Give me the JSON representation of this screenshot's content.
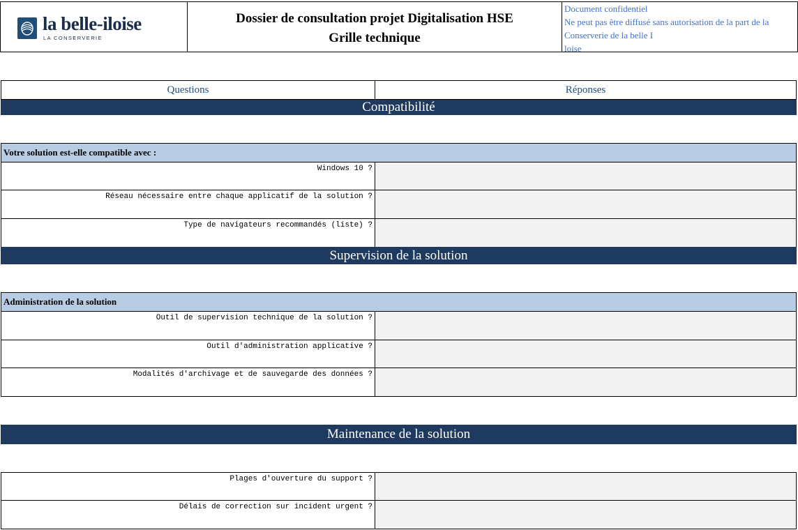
{
  "header": {
    "logo": {
      "name": "la belle-iloise",
      "tagline": "LA CONSERVERIE",
      "icon": "fish-tin-logo-icon"
    },
    "title_line1": "Dossier de consultation projet Digitalisation HSE",
    "title_line2": "Grille technique",
    "confidential": [
      "Document confidentiel",
      "Ne peut pas être diffusé sans autorisation de la part de la",
      "Conserverie de la  belle I",
      "loise"
    ]
  },
  "columns": {
    "questions": "Questions",
    "answers": "Réponses"
  },
  "sections": [
    {
      "title": "Compatibilité",
      "subheader": "Votre solution est-elle compatible avec :",
      "rows": [
        {
          "q": "Windows 10 ?",
          "a": ""
        },
        {
          "q": "Réseau nécessaire entre chaque applicatif de la solution ?",
          "a": ""
        },
        {
          "q": "Type de navigateurs recommandés (liste) ?",
          "a": ""
        }
      ]
    },
    {
      "title": "Supervision de la solution",
      "subheader": "Administration de la solution",
      "rows": [
        {
          "q": "Outil de supervision technique de la solution ?",
          "a": ""
        },
        {
          "q": "Outil d'administration applicative ?",
          "a": ""
        },
        {
          "q": "Modalités d'archivage et de sauvegarde des données ?",
          "a": ""
        }
      ]
    },
    {
      "title": "Maintenance de la solution",
      "rows": [
        {
          "q": "Plages d'ouverture du support ?",
          "a": ""
        },
        {
          "q": "Délais de correction sur incident urgent ?",
          "a": ""
        }
      ]
    }
  ],
  "colors": {
    "section_bg": "#1f3a5f",
    "subheader_bg": "#b8cce4",
    "answer_bg": "#f2f2f2",
    "link_blue": "#4472c4"
  }
}
